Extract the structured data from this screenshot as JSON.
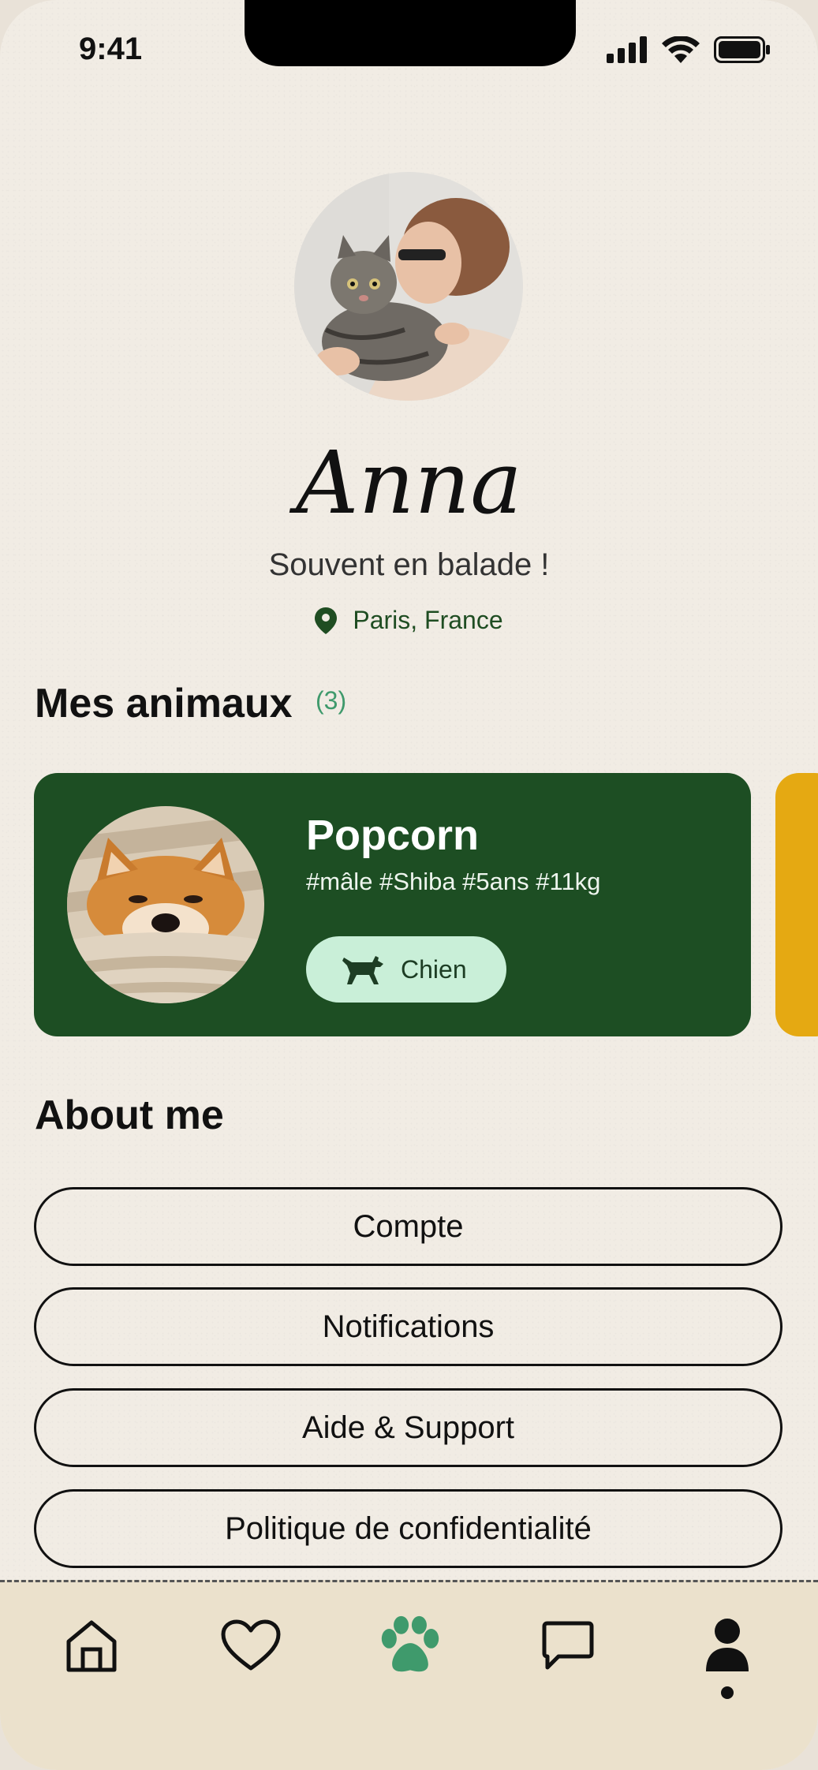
{
  "status_bar": {
    "time": "9:41"
  },
  "profile": {
    "name": "Anna",
    "tagline": "Souvent en balade !",
    "location": "Paris, France"
  },
  "pets_section": {
    "title": "Mes animaux",
    "count": "(3)",
    "cards": [
      {
        "name": "Popcorn",
        "tags": "#mâle #Shiba #5ans #11kg",
        "type_label": "Chien",
        "color": "#1d4e23"
      }
    ],
    "next_card_color": "#e5a912"
  },
  "about": {
    "title": "About me",
    "items": [
      "Compte",
      "Notifications",
      "Aide & Support",
      "Politique de confidentialité"
    ]
  },
  "nav": {
    "items": [
      "home-icon",
      "heart-icon",
      "paw-icon",
      "chat-icon",
      "profile-icon"
    ],
    "active": "paw-icon",
    "accent": "#3f9a6c"
  }
}
